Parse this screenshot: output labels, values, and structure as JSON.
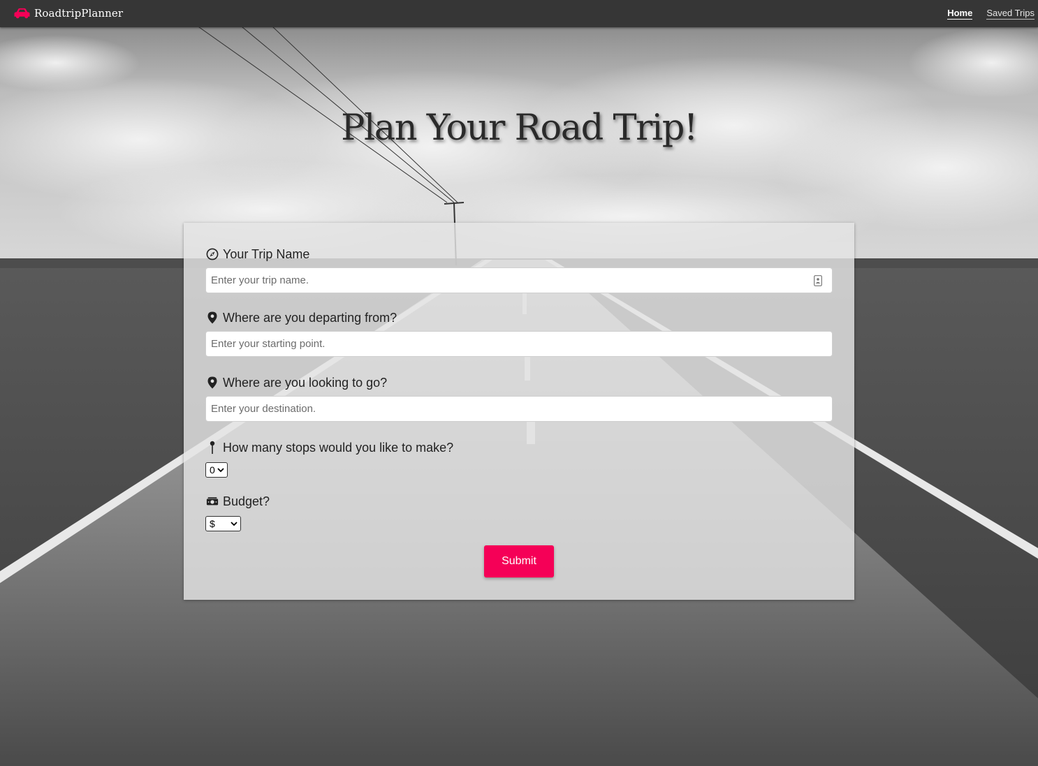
{
  "navbar": {
    "brand": "RoadtripPlanner",
    "brand_icon": "car-icon",
    "links": [
      {
        "label": "Home",
        "active": true
      },
      {
        "label": "Saved Trips",
        "active": false
      }
    ]
  },
  "hero": {
    "title": "Plan Your Road Trip!"
  },
  "form": {
    "trip_name": {
      "label": "Your Trip Name",
      "icon": "compass-icon",
      "placeholder": "Enter your trip name."
    },
    "origin": {
      "label": "Where are you departing from?",
      "icon": "map-pin-icon",
      "placeholder": "Enter your starting point."
    },
    "destination": {
      "label": "Where are you looking to go?",
      "icon": "map-pin-icon",
      "placeholder": "Enter your destination."
    },
    "stops": {
      "label": "How many stops would you like to make?",
      "icon": "push-pin-icon",
      "selected": "0"
    },
    "budget": {
      "label": "Budget?",
      "icon": "money-icon",
      "selected": "$"
    },
    "submit_label": "Submit"
  },
  "colors": {
    "navbar": "#363636",
    "accent": "#f50057",
    "panel": "#e4e4e4"
  }
}
